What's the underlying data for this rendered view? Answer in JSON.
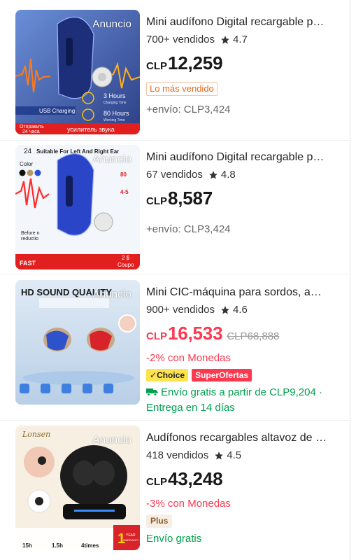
{
  "colors": {
    "accent_red": "#fd384f",
    "green": "#00a04f",
    "hot_tag": "#e86a1b"
  },
  "products": [
    {
      "ad_label": "Anuncio",
      "title": "Mini audífono Digital recargable para sordos, amplificador de sonido",
      "sold": "700+ vendidos",
      "rating": "4.7",
      "currency": "CLP",
      "price": "12,259",
      "tag": "Lo más vendido",
      "shipping": "+envío: CLP3,424",
      "image_text": {
        "l1": "USB Charging",
        "l2": "3 Hours",
        "l3": "Charging Time",
        "l4": "80 Hours",
        "l5": "Working Time",
        "l6": "Отправить",
        "l7": "24 часа",
        "l8": "усилитель звука"
      }
    },
    {
      "ad_label": "Anuncio",
      "title": "Mini audífono Digital recargable para sordos",
      "sold": "67 vendidos",
      "rating": "4.8",
      "currency": "CLP",
      "price": "8,587",
      "shipping": "+envío: CLP3,424",
      "image_text": {
        "l1": "Suitable For Left And Right Ear",
        "l2": "Color",
        "l3": "80",
        "l4": "4-5",
        "l5": "Before n",
        "l6": "reductio",
        "l7": "FAST",
        "l8": "2 $",
        "l9": "Coupo",
        "l10": "24"
      }
    },
    {
      "ad_label": "Anuncio",
      "title": "Mini CIC-máquina para sordos, amplificador de sonido",
      "sold": "900+ vendidos",
      "rating": "4.6",
      "currency": "CLP",
      "price": "16,533",
      "original_price": "CLP68,888",
      "coins": "-2% con Monedas",
      "badge_choice": "Choice",
      "badge_super": "SuperOfertas",
      "free_shipping": "Envío gratis a partir de CLP9,204 ·",
      "delivery": "Entrega en 14 días",
      "image_text": {
        "l1": "HD SOUND QUALITY"
      }
    },
    {
      "ad_label": "Anuncio",
      "title": "Audífonos recargables altavoz de bolsillo",
      "sold": "418 vendidos",
      "rating": "4.5",
      "currency": "CLP",
      "price": "43,248",
      "coins": "-3% con Monedas",
      "badge_plus": "Plus",
      "free_shipping": "Envío gratis",
      "image_text": {
        "l1": "Lonsen",
        "l2": "1",
        "l3": "YEAR",
        "l4": "WARRANTY",
        "l5": "15h",
        "l6": "1.5h",
        "l7": "4times"
      }
    }
  ]
}
